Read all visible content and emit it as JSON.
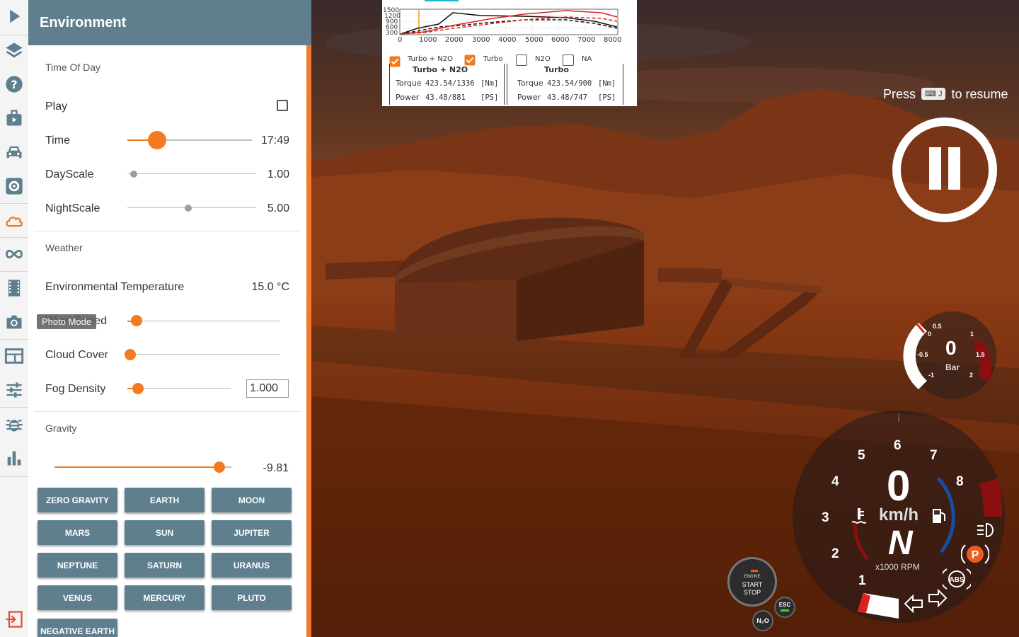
{
  "panel": {
    "title": "Environment",
    "time_of_day": {
      "section": "Time Of Day",
      "play_label": "Play",
      "time_label": "Time",
      "time_value": "17:49",
      "time_fraction": 0.24,
      "dayscale_label": "DayScale",
      "dayscale_value": "1.00",
      "dayscale_fraction": 0.05,
      "nightscale_label": "NightScale",
      "nightscale_value": "5.00",
      "nightscale_fraction": 0.47
    },
    "weather": {
      "section": "Weather",
      "temperature_label": "Environmental Temperature",
      "temperature_value": "15.0 °C",
      "wind_label": "Wind Speed",
      "wind_fraction": 0.06,
      "cloud_label": "Cloud Cover",
      "cloud_fraction": 0.02,
      "fog_label": "Fog Density",
      "fog_value": "1.000",
      "fog_fraction": 0.1
    },
    "gravity": {
      "section": "Gravity",
      "value": "-9.81",
      "fraction": 0.93,
      "presets": [
        "ZERO GRAVITY",
        "EARTH",
        "MOON",
        "MARS",
        "SUN",
        "JUPITER",
        "NEPTUNE",
        "SATURN",
        "URANUS",
        "VENUS",
        "MERCURY",
        "PLUTO",
        "NEGATIVE EARTH"
      ]
    }
  },
  "tooltip": "Photo Mode",
  "rail_icons": [
    "play-icon",
    "layers-icon",
    "help-icon",
    "missions-icon",
    "vehicle-icon",
    "settings-icon",
    "environment-icon",
    "track-icon",
    "replay-icon",
    "camera-icon",
    "ui-apps-icon",
    "tuning-icon",
    "debug-icon",
    "stats-icon",
    "exit-icon"
  ],
  "graph": {
    "x_ticks": [
      "0",
      "1000",
      "2000",
      "3000",
      "4000",
      "5000",
      "6000",
      "7000",
      "8000"
    ],
    "y_left_ticks": [
      "1500",
      "1200",
      "900",
      "600",
      "300"
    ],
    "legend": [
      {
        "label": "Turbo + N2O",
        "checked": true
      },
      {
        "label": "Turbo",
        "checked": true
      },
      {
        "label": "N2O",
        "checked": false
      },
      {
        "label": "NA",
        "checked": false
      }
    ],
    "col1": {
      "title": "Turbo + N2O",
      "torque_label": "Torque",
      "torque_value": "423.54/1336",
      "torque_unit": "[Nm]",
      "power_label": "Power",
      "power_value": "43.48/881",
      "power_unit": "[PS]"
    },
    "col2": {
      "title": "Turbo",
      "torque_label": "Torque",
      "torque_value": "423.54/900",
      "torque_unit": "[Nm]",
      "power_label": "Power",
      "power_value": "43.48/747",
      "power_unit": "[PS]"
    }
  },
  "hud": {
    "press_prefix": "Press",
    "press_key": "⌨ J",
    "press_suffix": "to resume",
    "boost": {
      "value": "0",
      "unit": "Bar",
      "ticks": [
        "-1",
        "-0.5",
        "0",
        "0.5",
        "1",
        "1.5",
        "2"
      ]
    },
    "speed": {
      "value": "0",
      "unit": "km/h",
      "gear": "N",
      "rpm_unit": "x1000 RPM",
      "rpm_ticks": [
        "1",
        "2",
        "3",
        "4",
        "5",
        "6",
        "7",
        "8"
      ]
    },
    "engine_button": {
      "line1": "ENGINE",
      "line2": "START",
      "line3": "STOP"
    },
    "esc_label": "ESC",
    "nos_label": "N₂O",
    "abs_label": "ABS",
    "park_label": "P"
  },
  "colors": {
    "accent": "#f07a1d",
    "header": "#5f7f8f"
  }
}
